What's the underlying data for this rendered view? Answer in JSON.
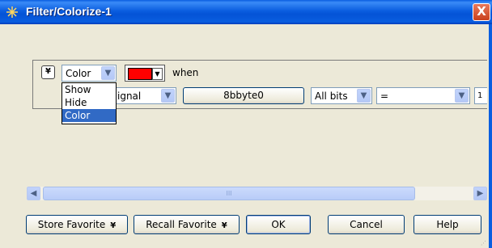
{
  "window": {
    "title": "Filter/Colorize-1",
    "close_symbol": "X"
  },
  "rule": {
    "expander_symbol": "¥",
    "action": {
      "selected": "Color",
      "options": [
        "Show",
        "Hide",
        "Color"
      ]
    },
    "color": "#ff0000",
    "when_label": "when",
    "source": {
      "value": "Signal",
      "visible_text": "ignal"
    },
    "name_button_label": "8bbyte0",
    "bits": {
      "value": "All bits"
    },
    "operator": {
      "value": "="
    },
    "value_edge": "1"
  },
  "scrollbar": {
    "thumb_grip": "III"
  },
  "buttons": {
    "store_favorite": "Store Favorite",
    "recall_favorite": "Recall Favorite",
    "ok": "OK",
    "cancel": "Cancel",
    "help": "Help"
  }
}
